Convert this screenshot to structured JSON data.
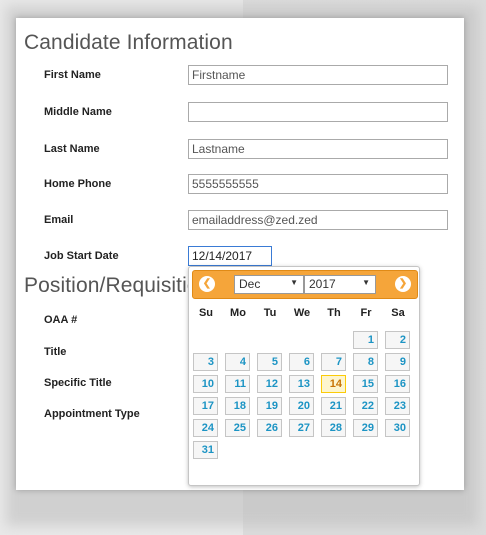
{
  "sections": {
    "candidate_title": "Candidate Information",
    "position_title": "Position/Requisition"
  },
  "candidate_fields": [
    {
      "label": "First Name",
      "value": "Firstname"
    },
    {
      "label": "Middle Name",
      "value": ""
    },
    {
      "label": "Last Name",
      "value": "Lastname"
    },
    {
      "label": "Home Phone",
      "value": "5555555555"
    },
    {
      "label": "Email",
      "value": "emailaddress@zed.zed"
    },
    {
      "label": "Job Start Date",
      "value": "12/14/2017"
    }
  ],
  "position_fields": [
    "OAA #",
    "Title",
    "Specific Title",
    "Appointment Type"
  ],
  "datepicker": {
    "prev_icon": "prev-arrow-icon",
    "next_icon": "next-arrow-icon",
    "month": "Dec",
    "year": "2017",
    "weekdays": [
      "Su",
      "Mo",
      "Tu",
      "We",
      "Th",
      "Fr",
      "Sa"
    ],
    "today": "14",
    "days": [
      "1",
      "2",
      "3",
      "4",
      "5",
      "6",
      "7",
      "8",
      "9",
      "10",
      "11",
      "12",
      "13",
      "14",
      "15",
      "16",
      "17",
      "18",
      "19",
      "20",
      "21",
      "22",
      "23",
      "24",
      "25",
      "26",
      "27",
      "28",
      "29",
      "30",
      "31"
    ],
    "accent_color": "#f5a53a"
  }
}
